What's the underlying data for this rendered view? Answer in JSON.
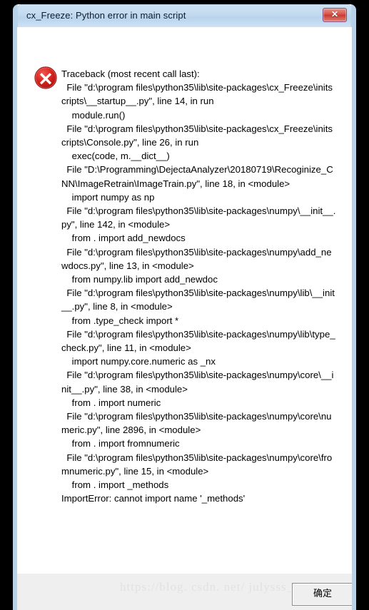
{
  "window": {
    "title": "cx_Freeze: Python error in main script",
    "close_label": "✕",
    "close_icon": "close-icon"
  },
  "content": {
    "error_icon": "error-circle-x-icon",
    "traceback": "Traceback (most recent call last):\n  File \"d:\\program files\\python35\\lib\\site-packages\\cx_Freeze\\initscripts\\__startup__.py\", line 14, in run\n    module.run()\n  File \"d:\\program files\\python35\\lib\\site-packages\\cx_Freeze\\initscripts\\Console.py\", line 26, in run\n    exec(code, m.__dict__)\n  File \"D:\\Programming\\DejectaAnalyzer\\20180719\\Recoginize_CNN\\ImageRetrain\\ImageTrain.py\", line 18, in <module>\n    import numpy as np\n  File \"d:\\program files\\python35\\lib\\site-packages\\numpy\\__init__.py\", line 142, in <module>\n    from . import add_newdocs\n  File \"d:\\program files\\python35\\lib\\site-packages\\numpy\\add_newdocs.py\", line 13, in <module>\n    from numpy.lib import add_newdoc\n  File \"d:\\program files\\python35\\lib\\site-packages\\numpy\\lib\\__init__.py\", line 8, in <module>\n    from .type_check import *\n  File \"d:\\program files\\python35\\lib\\site-packages\\numpy\\lib\\type_check.py\", line 11, in <module>\n    import numpy.core.numeric as _nx\n  File \"d:\\program files\\python35\\lib\\site-packages\\numpy\\core\\__init__.py\", line 38, in <module>\n    from . import numeric\n  File \"d:\\program files\\python35\\lib\\site-packages\\numpy\\core\\numeric.py\", line 2896, in <module>\n    from . import fromnumeric\n  File \"d:\\program files\\python35\\lib\\site-packages\\numpy\\core\\fromnumeric.py\", line 15, in <module>\n    from . import _methods\nImportError: cannot import name '_methods'"
  },
  "footer": {
    "ok_label": "确定",
    "watermark": "https://blog. csdn. net/ julysss_nudt"
  },
  "colors": {
    "titlebar": "#c2daf0",
    "window_border": "#b7d2e9",
    "close_button": "#d9564c",
    "error_red": "#cf1a1a",
    "footer_bg": "#efefef",
    "desktop": "#000000",
    "text": "#000000"
  }
}
